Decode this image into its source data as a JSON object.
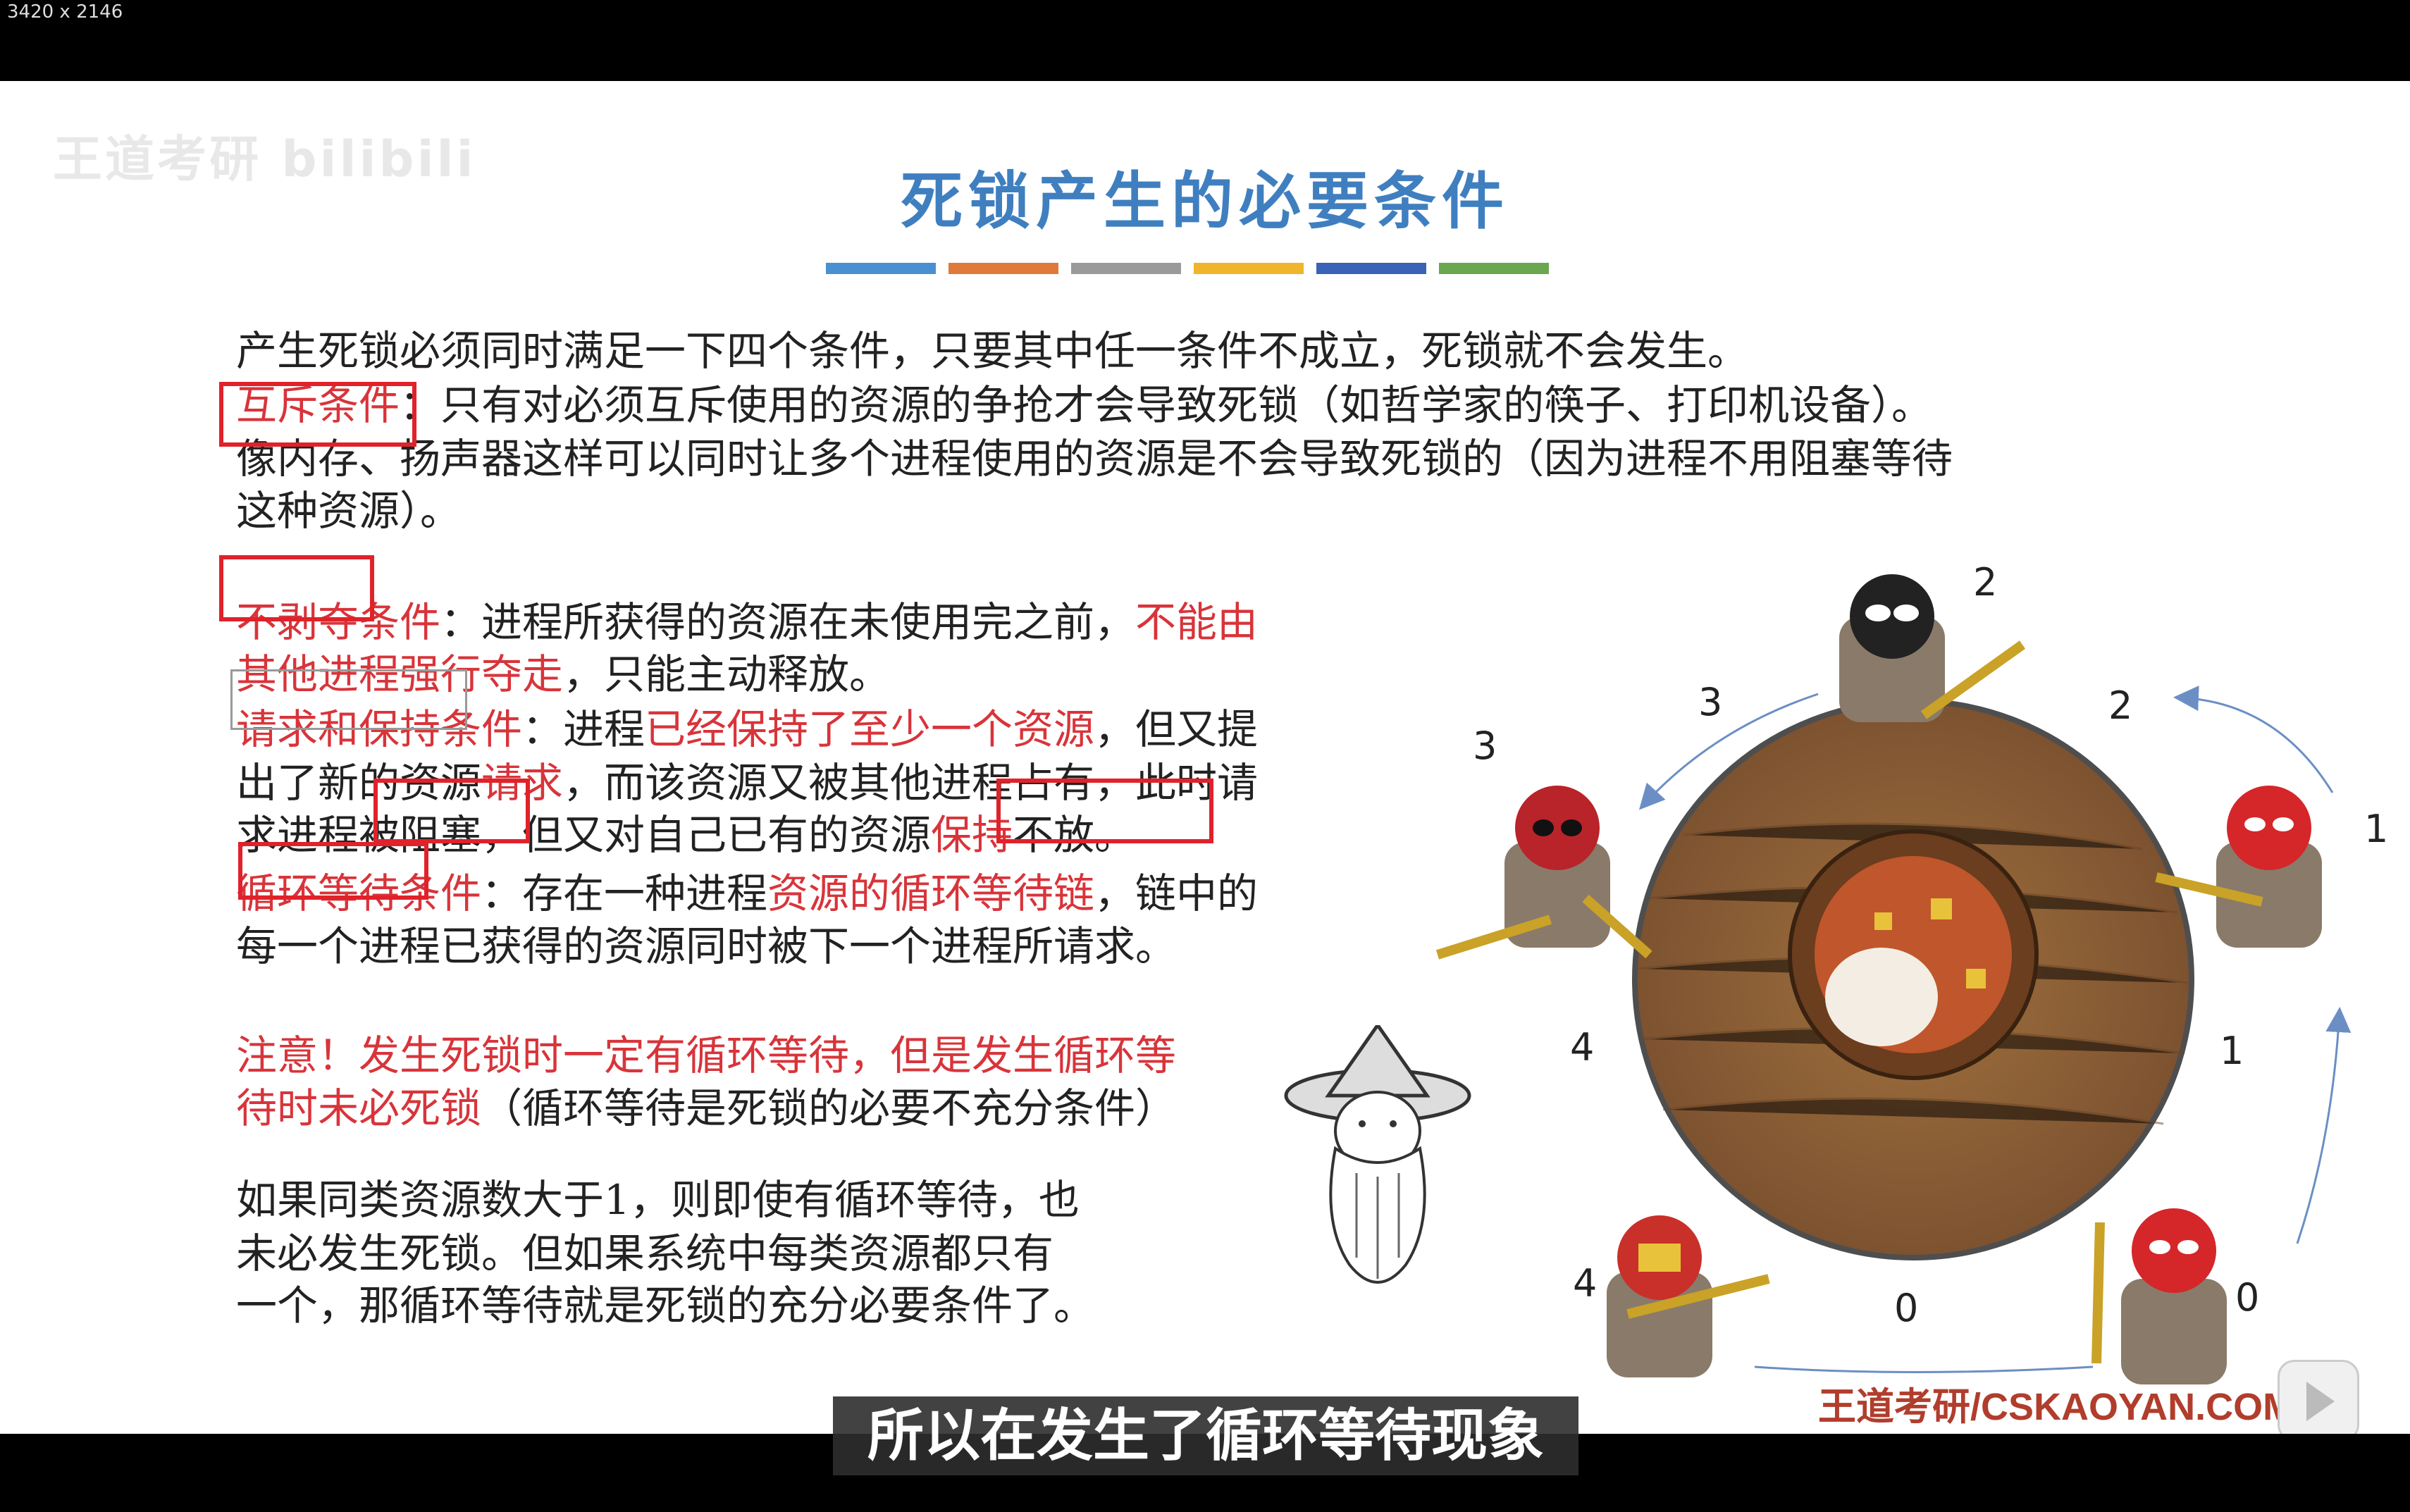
{
  "screen": {
    "dimensions": "3420 x 2146"
  },
  "watermark": {
    "text": "王道考研 bilibili"
  },
  "slide": {
    "title": "死锁产生的必要条件",
    "stripe_colors": [
      "#4a8fd1",
      "#e07a3a",
      "#9a9a9a",
      "#f1b52b",
      "#3a63b8",
      "#6aa84f"
    ],
    "intro": "产生死锁必须同时满足一下四个条件，只要其中任一条件不成立，死锁就不会发生。",
    "mutex": {
      "label": "互斥条件",
      "line1": "：只有对必须互斥使用的资源的争抢才会导致死锁（如哲学家的筷子、打印机设备）。",
      "line2": "像内存、扬声器这样可以同时让多个进程使用的资源是不会导致死锁的（因为进程不用阻塞等待",
      "line3": "这种资源）。"
    },
    "no_preempt": {
      "label": "不剥夺条件",
      "text1": "：进程所获得的资源在未使用完之前，",
      "red1": "不能由",
      "red2": "其他进程强行夺走",
      "text2": "，只能主动释放。"
    },
    "hold_wait": {
      "label": "请求和保持条件",
      "text1": "：进程",
      "red1": "已经保持了至少一个资源",
      "text2": "，但又提",
      "text3": "出了新的资源",
      "red2": "请求",
      "text4": "，而该资源又被其他进程占有，此时请",
      "text5": "求进程被阻塞，但又对自己已有的资源",
      "red3": "保持",
      "text6": "不放。"
    },
    "circular": {
      "label": "循环等待条件",
      "text1": "：存在一种进程",
      "red1": "资源的循环等待链",
      "text2": "，链中的",
      "text3": "每一个进程已获得的资源同时被下一个进程所请求。"
    },
    "note": {
      "red1": "注意！发生死锁时一定有循环等待，但是发生循环等",
      "red2": "待时未必死锁",
      "text": "（循环等待是死锁的必要不充分条件）"
    },
    "extra": {
      "line1": "如果同类资源数大于1，则即使有循环等待，也",
      "line2": "未必发生死锁。但如果系统中每类资源都只有",
      "line3": "一个，那循环等待就是死锁的充分必要条件了。"
    },
    "diagram": {
      "process_labels": [
        "2",
        "1",
        "0",
        "4",
        "3"
      ],
      "edge_labels": [
        "2",
        "1",
        "0",
        "4",
        "3"
      ]
    },
    "footer": "王道考研/CSKAOYAN.COM"
  },
  "subtitle": "所以在发生了循环等待现象"
}
